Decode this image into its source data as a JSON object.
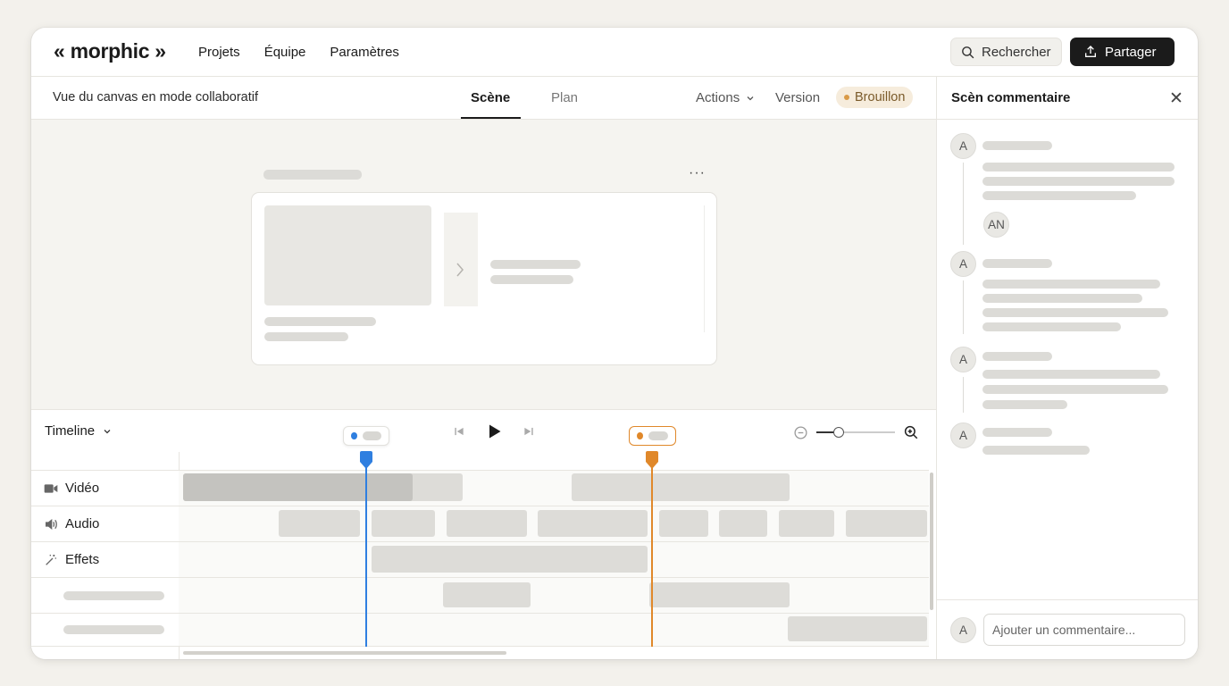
{
  "app": {
    "logo": "« morphic »"
  },
  "nav": {
    "items": [
      "Projets",
      "Équipe",
      "Paramètres"
    ]
  },
  "header": {
    "search_label": "Rechercher",
    "share_label": "Partager"
  },
  "subbar": {
    "title": "Vue du canvas en mode collaboratif",
    "tabs": [
      {
        "label": "Scène",
        "active": true
      },
      {
        "label": "Plan",
        "active": false
      }
    ],
    "actions_label": "Actions",
    "version_label": "Version",
    "status_badge": "Brouillon"
  },
  "canvas": {
    "more_label": "···"
  },
  "timeline": {
    "label": "Timeline",
    "tracks": [
      "Vidéo",
      "Audio",
      "Effets"
    ],
    "zoom_level": 0.28,
    "playheads": [
      {
        "color": "#2f7fe0"
      },
      {
        "color": "#e0882a"
      }
    ]
  },
  "panel": {
    "title": "Scèn commentaire",
    "avatars": [
      "A",
      "AN",
      "A",
      "A",
      "A"
    ],
    "footer_avatar": "A",
    "input_placeholder": "Ajouter un commentaire..."
  },
  "colors": {
    "accent_dark": "#1b1b1b",
    "badge_bg": "#f6ecdc",
    "badge_dot": "#d99a47",
    "playhead_blue": "#2f7fe0",
    "playhead_orange": "#e0882a"
  }
}
